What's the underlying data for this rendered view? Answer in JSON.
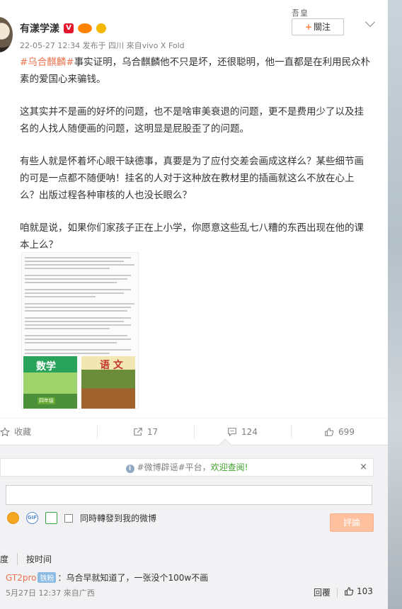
{
  "post": {
    "username": "有漾学漾",
    "badges": [
      "V",
      "vip",
      "gold"
    ],
    "meta": "22-05-27 12:34 发布于 四川 來自vivo X Fold",
    "follow_label": "關注",
    "follow_deco": "吾皇",
    "paragraphs": [
      {
        "topic": "#乌合麒麟#",
        "text": "事实证明，乌合麒麟他不只是坏，还很聪明，他一直都是在利用民众朴素的爱国心来骗钱。"
      },
      {
        "topic": "",
        "text": "这其实并不是画的好坏的问题，也不是啥审美衰退的问题，更不是费用少了以及挂名的人找人随便画的问题，这明显是屁股歪了的问题。"
      },
      {
        "topic": "",
        "text": "有些人就是怀着坏心眼干缺德事，真要是为了应付交差会画成这样么？某些细节画的可是一点都不随便呐！挂名的人对于这种放在教材里的插画就这么不放在心上么？出版过程各种审核的人也没长眼么？"
      },
      {
        "topic": "",
        "text": "咱就是说，如果你们家孩子正在上小学，你愿意这些乱七八糟的东西出现在他的课本上么？"
      }
    ],
    "attachment": {
      "book1_title": "数学",
      "book1_grade": "四年级",
      "book2_title": "语 文"
    }
  },
  "actions": {
    "favorite": "收藏",
    "repost_count": "17",
    "comment_count": "124",
    "like_count": "699"
  },
  "comment_panel": {
    "notice_pre": "#微博辟谣#平台，",
    "notice_hl": "欢迎查阅!",
    "notice_close": "×",
    "input_placeholder": "",
    "also_repost": "同時轉發到我的微博",
    "submit": "評論",
    "sort_hot": "度",
    "sort_time": "按时间",
    "comments": [
      {
        "nick": "GT2pro",
        "fan_badge": "铁粉",
        "text": "：乌合早就知道了，一张没个100w不画",
        "meta": "5月27日 12:37 來自广西",
        "reply": "回覆",
        "likes": "103"
      }
    ]
  }
}
